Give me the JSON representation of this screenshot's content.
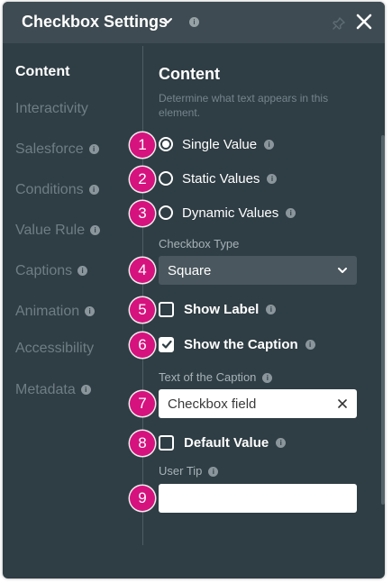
{
  "header": {
    "title": "Checkbox Settings"
  },
  "nav": [
    {
      "label": "Content",
      "active": true,
      "info": false
    },
    {
      "label": "Interactivity",
      "active": false,
      "info": false
    },
    {
      "label": "Salesforce",
      "active": false,
      "info": true
    },
    {
      "label": "Conditions",
      "active": false,
      "info": true
    },
    {
      "label": "Value Rule",
      "active": false,
      "info": true
    },
    {
      "label": "Captions",
      "active": false,
      "info": true
    },
    {
      "label": "Animation",
      "active": false,
      "info": true
    },
    {
      "label": "Accessibility",
      "active": false,
      "info": false
    },
    {
      "label": "Metadata",
      "active": false,
      "info": true
    }
  ],
  "content": {
    "title": "Content",
    "description": "Determine what text appears in this element.",
    "value_options": [
      "Single Value",
      "Static Values",
      "Dynamic Values"
    ],
    "selected_value_option": "Single Value",
    "checkbox_type_label": "Checkbox Type",
    "checkbox_type_value": "Square",
    "show_label": "Show Label",
    "show_label_checked": false,
    "show_caption": "Show the Caption",
    "show_caption_checked": true,
    "caption_text_label": "Text of the Caption",
    "caption_text_value": "Checkbox field",
    "default_value": "Default Value",
    "default_value_checked": false,
    "user_tip_label": "User Tip",
    "user_tip_value": ""
  },
  "badges": [
    "1",
    "2",
    "3",
    "4",
    "5",
    "6",
    "7",
    "8",
    "9"
  ],
  "colors": {
    "panel": "#2f3d44",
    "header": "#3e4b52",
    "badge": "#d6127e",
    "muted": "#6f7d84"
  }
}
